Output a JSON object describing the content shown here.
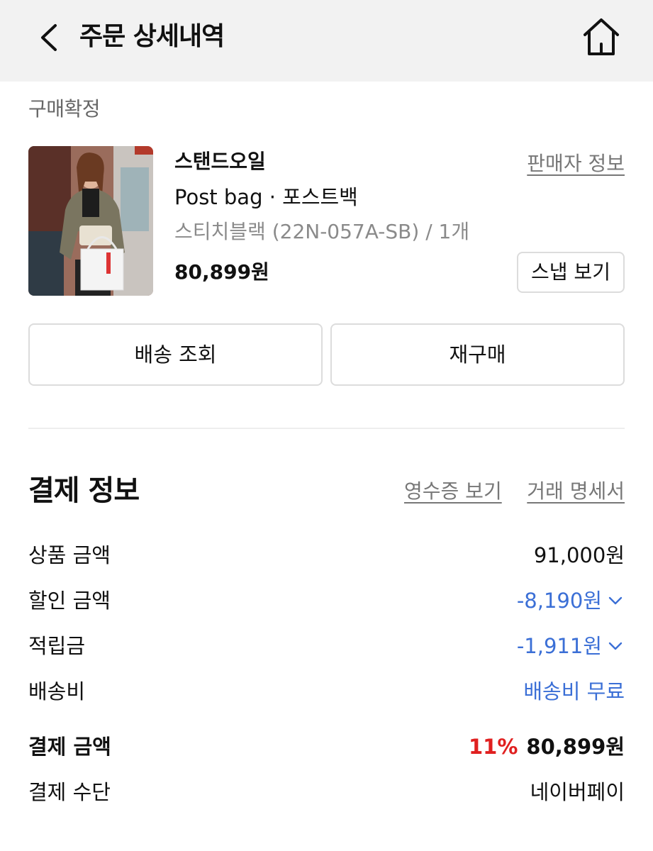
{
  "header": {
    "title": "주문 상세내역",
    "back_icon": "chevron-left-icon",
    "home_icon": "home-icon"
  },
  "order": {
    "status": "구매확정",
    "product": {
      "brand": "스탠드오일",
      "name": "Post bag · 포스트백",
      "option": "스티치블랙 (22N-057A-SB) / 1개",
      "price": "80,899원",
      "seller_link": "판매자 정보",
      "snap_button": "스냅 보기"
    },
    "buttons": {
      "track": "배송 조회",
      "rebuy": "재구매"
    }
  },
  "payment": {
    "title": "결제 정보",
    "receipt_link": "영수증 보기",
    "statement_link": "거래 명세서",
    "rows": [
      {
        "label": "상품 금액",
        "value": "91,000원"
      },
      {
        "label": "할인 금액",
        "value": "-8,190원"
      },
      {
        "label": "적립금",
        "value": "-1,911원"
      },
      {
        "label": "배송비",
        "value": "배송비 무료"
      }
    ],
    "total": {
      "label": "결제 금액",
      "discount_rate": "11%",
      "value": "80,899원"
    },
    "method": {
      "label": "결제 수단",
      "value": "네이버페이"
    }
  },
  "colors": {
    "header_bg": "#f2f2f2",
    "accent_blue": "#3b6fd6",
    "accent_red": "#e02020",
    "muted_text": "#777777"
  }
}
